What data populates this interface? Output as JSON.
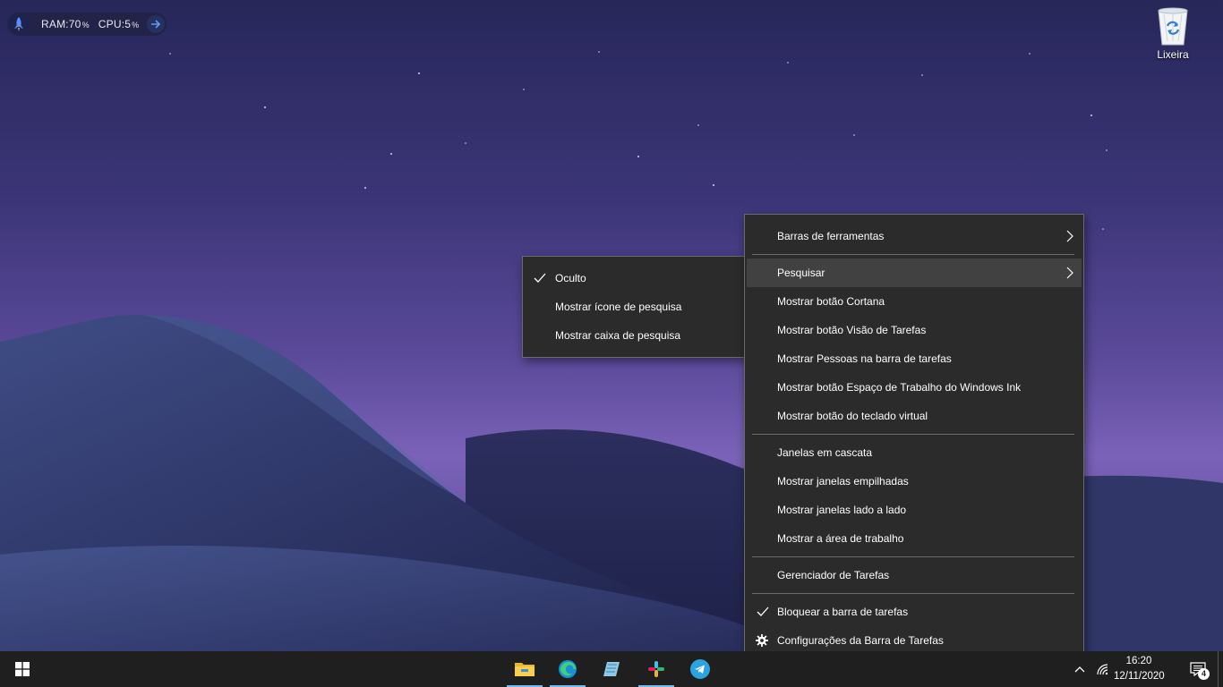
{
  "widget": {
    "ram_label": "RAM:70",
    "ram_unit": "%",
    "cpu_label": "CPU:5",
    "cpu_unit": "%"
  },
  "desktop_icons": {
    "recycle_bin": "Lixeira"
  },
  "context_menu": {
    "toolbars": "Barras de ferramentas",
    "search": "Pesquisar",
    "show_cortana": "Mostrar botão Cortana",
    "show_task_view": "Mostrar botão Visão de Tarefas",
    "show_people": "Mostrar Pessoas na barra de tarefas",
    "show_ink": "Mostrar botão Espaço de Trabalho do Windows Ink",
    "show_keyboard": "Mostrar botão do teclado virtual",
    "cascade": "Janelas em cascata",
    "stacked": "Mostrar janelas empilhadas",
    "side_by_side": "Mostrar janelas lado a lado",
    "show_desktop": "Mostrar a área de trabalho",
    "task_manager": "Gerenciador de Tarefas",
    "lock_taskbar": "Bloquear a barra de tarefas",
    "taskbar_settings": "Configurações da Barra de Tarefas"
  },
  "search_submenu": {
    "hidden": "Oculto",
    "show_icon": "Mostrar ícone de pesquisa",
    "show_box": "Mostrar caixa de pesquisa"
  },
  "taskbar": {
    "time": "16:20",
    "date": "12/11/2020",
    "notification_count": "4"
  },
  "colors": {
    "menu_bg": "#2b2b2b",
    "taskbar_bg": "#1f1f1f",
    "accent": "#76b9ed"
  },
  "icons": [
    "rocket-icon",
    "arrow-right-icon",
    "recycle-bin-icon",
    "chevron-right-icon",
    "checkmark-icon",
    "gear-icon",
    "windows-start-icon",
    "file-explorer-icon",
    "edge-icon",
    "notepad-icon",
    "slack-icon",
    "telegram-icon",
    "chevron-up-icon",
    "wifi-icon",
    "notification-center-icon"
  ]
}
